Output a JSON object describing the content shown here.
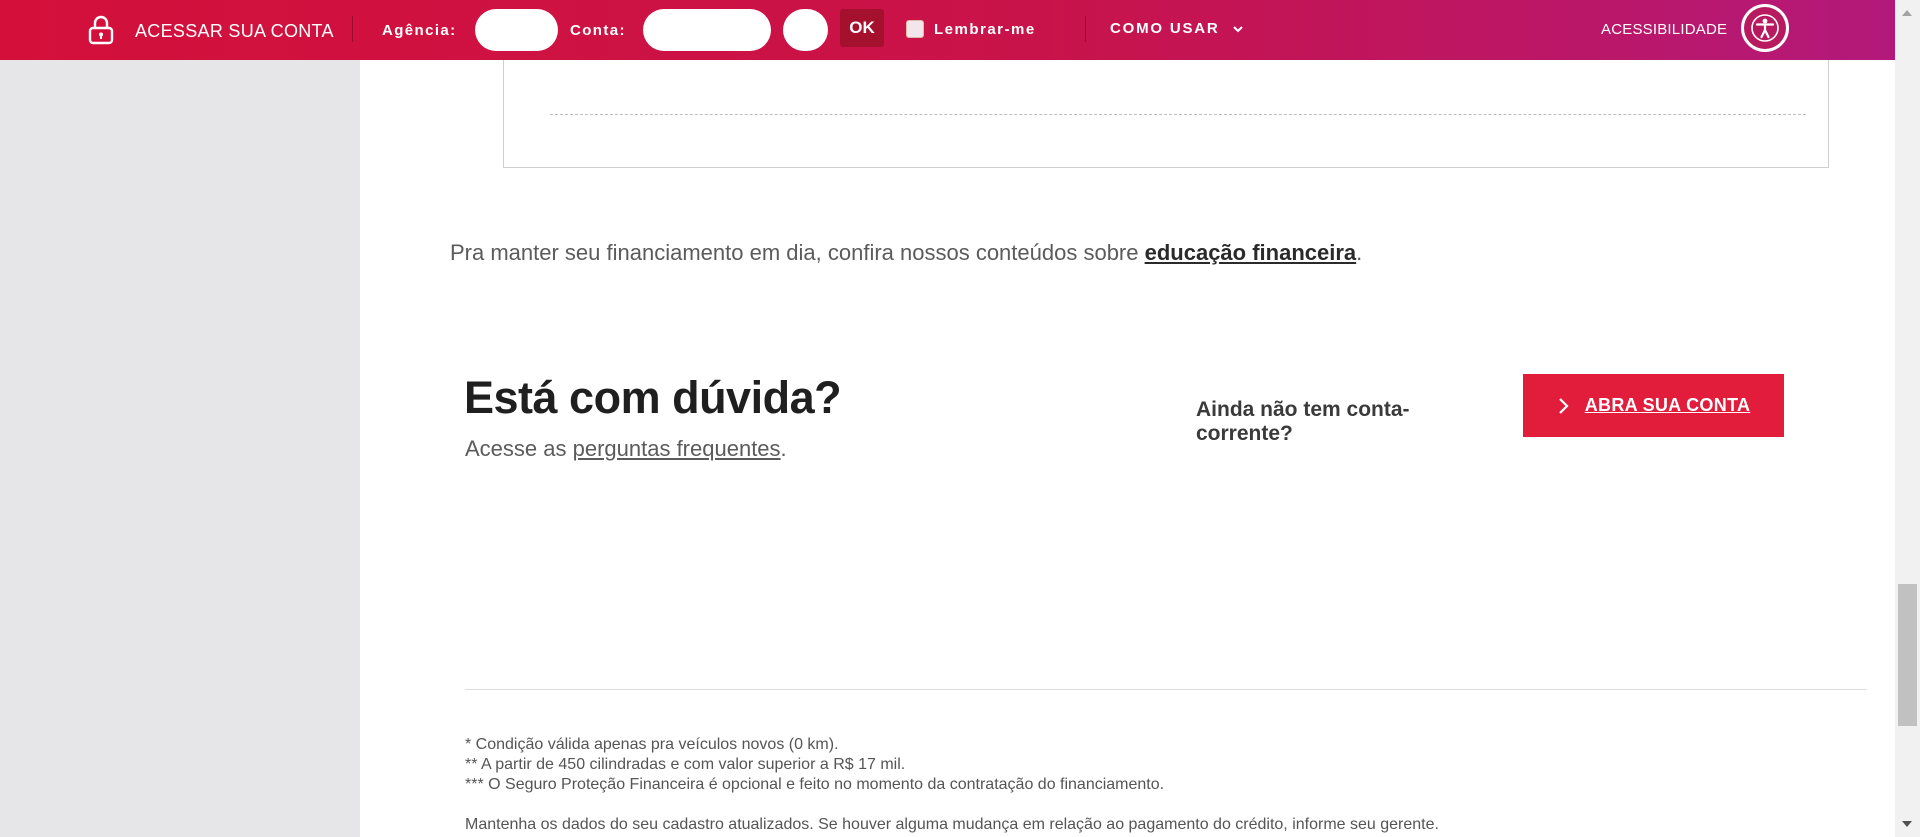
{
  "topbar": {
    "access_label": "ACESSAR SUA CONTA",
    "agency_label": "Agência:",
    "account_label": "Conta:",
    "ok_label": "OK",
    "remember_label": "Lembrar-me",
    "howto_label": "COMO USAR",
    "accessibility_label": "ACESSIBILIDADE"
  },
  "main": {
    "edu_prefix": "Pra manter seu financiamento em dia, confira nossos conteúdos sobre ",
    "edu_link": "educação financeira",
    "edu_suffix": ".",
    "faq_title": "Está com dúvida?",
    "faq_prefix": "Acesse as ",
    "faq_link": "perguntas frequentes",
    "faq_suffix": ".",
    "no_account": "Ainda não tem conta-corrente?",
    "open_account_button": "ABRA SUA CONTA"
  },
  "footnotes": {
    "note1": "* Condição válida apenas pra veículos novos (0 km).",
    "note2": "** A partir de 450 cilindradas e com valor superior a R$ 17 mil.",
    "note3": "*** O Seguro Proteção Financeira é opcional e feito no momento da contratação do financiamento.",
    "note4": "Mantenha os dados do seu cadastro atualizados. Se houver alguma mudança em relação ao pagamento do crédito, informe seu gerente."
  },
  "colors": {
    "topbar_start": "#d4103a",
    "topbar_end": "#b3197a",
    "button_red": "#e21d3c",
    "ok_button": "#a5102d"
  },
  "icons": {
    "lock": "lock-icon",
    "chevron": "chevron-down-icon",
    "accessibility": "accessibility-icon",
    "arrow": "arrow-right-icon"
  }
}
